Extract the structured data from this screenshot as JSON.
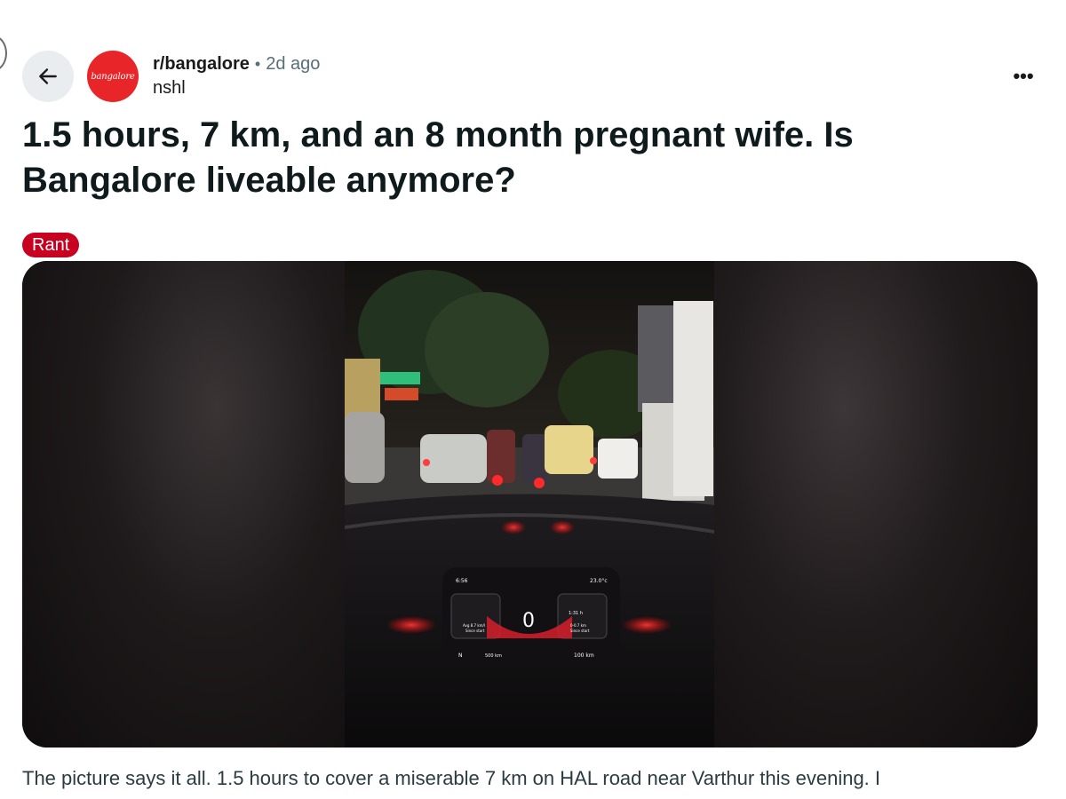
{
  "post": {
    "avatar_text": "bangalore",
    "subreddit": "r/bangalore",
    "separator": "•",
    "time_ago": "2d ago",
    "author": "nshl",
    "more_label": "•••",
    "title": "1.5 hours, 7 km, and an 8 month pregnant wife. Is Bangalore liveable anymore?",
    "flair": "Rant",
    "flair_color": "#c7011f",
    "body": "The picture says it all. 1.5 hours to cover a miserable 7 km on HAL road near Varthur this evening. I"
  },
  "dashboard": {
    "clock": "6:56",
    "temperature": "23.0°c",
    "speed": "0",
    "left_panel_line1": "Avg 8.7 km/l",
    "left_panel_line2": "Since start",
    "right_panel_line1": "1:31 h",
    "right_panel_line2": "0-0.7 km",
    "right_panel_line3": "Since start",
    "gear": "N",
    "odometer": "500 km",
    "range": "100 km"
  },
  "icons": {
    "back": "arrow-left-icon",
    "more": "more-horizontal-icon"
  }
}
